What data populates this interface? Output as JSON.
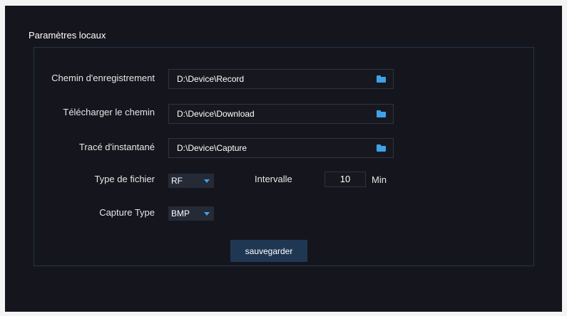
{
  "section": {
    "title": "Paramètres locaux"
  },
  "fields": {
    "record_path": {
      "label": "Chemin d'enregistrement",
      "value": "D:\\Device\\Record",
      "icon": "folder-icon"
    },
    "download_path": {
      "label": "Télécharger le chemin",
      "value": "D:\\Device\\Download",
      "icon": "folder-icon"
    },
    "capture_path": {
      "label": "Tracé d'instantané",
      "value": "D:\\Device\\Capture",
      "icon": "folder-icon"
    },
    "file_type": {
      "label": "Type de fichier",
      "value": "RF"
    },
    "interval": {
      "label": "Intervalle",
      "value": "10",
      "unit": "Min"
    },
    "capture_type": {
      "label": "Capture Type",
      "value": "BMP"
    }
  },
  "actions": {
    "save_label": "sauvegarder"
  },
  "colors": {
    "background": "#15161d",
    "accent": "#3ea2ea",
    "button": "#203754",
    "border": "#263347"
  }
}
